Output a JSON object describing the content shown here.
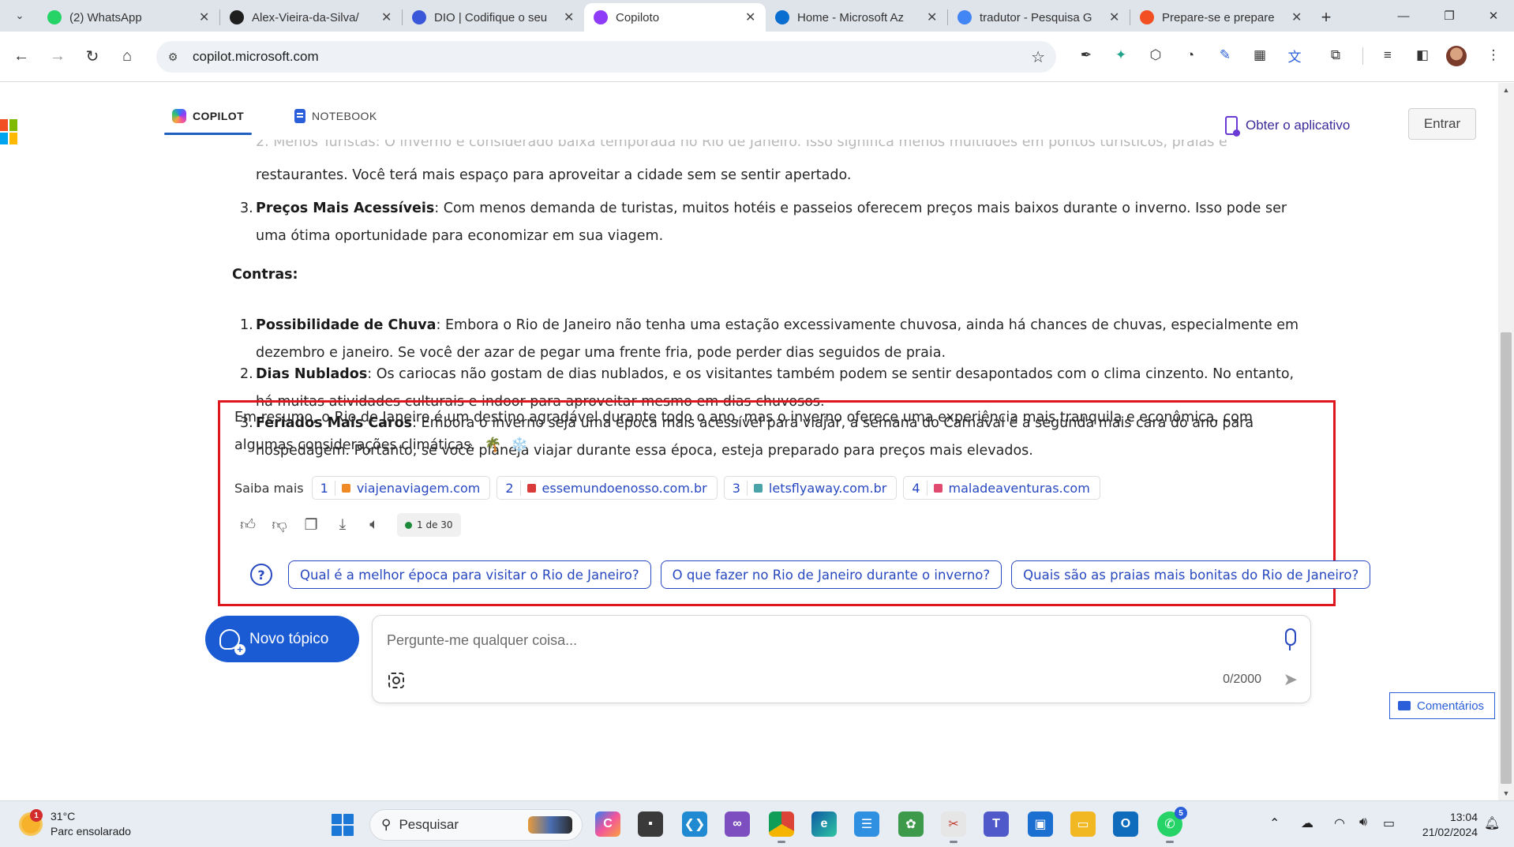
{
  "browser": {
    "tabs": [
      {
        "title": "(2) WhatsApp",
        "icon": "whatsapp-icon",
        "color": "#25d366",
        "active": false
      },
      {
        "title": "Alex-Vieira-da-Silva/",
        "icon": "github-icon",
        "color": "#1f1f1f",
        "active": false
      },
      {
        "title": "DIO | Codifique o seu",
        "icon": "dio-icon",
        "color": "#3b57d9",
        "active": false
      },
      {
        "title": "Copiloto",
        "icon": "copilot-icon",
        "color": "#8e3cf7",
        "active": true
      },
      {
        "title": "Home - Microsoft Az",
        "icon": "azure-icon",
        "color": "#0a6ed1",
        "active": false
      },
      {
        "title": "tradutor - Pesquisa G",
        "icon": "google-icon",
        "color": "#4285f4",
        "active": false
      },
      {
        "title": "Prepare-se e prepare",
        "icon": "microsoft-icon",
        "color": "#f25022",
        "active": false
      }
    ],
    "url": "copilot.microsoft.com"
  },
  "header": {
    "nav_copilot": "COPILOT",
    "nav_notebook": "NOTEBOOK",
    "get_app": "Obter o aplicativo",
    "sign_in": "Entrar"
  },
  "chat": {
    "clipped_item": "2.  Menos Turistas: O inverno é considerado baixa temporada no Rio de Janeiro. Isso significa menos multidões em pontos turísticos, praias e",
    "pros_item2_cont": "restaurantes. Você terá mais espaço para aproveitar a cidade sem se sentir apertado.",
    "pros_item3_num": "3.",
    "pros_item3_title": "Preços Mais Acessíveis",
    "pros_item3_body": ": Com menos demanda de turistas, muitos hotéis e passeios oferecem preços mais baixos durante o inverno. Isso pode ser uma ótima oportunidade para economizar em sua viagem.",
    "cons_heading": "Contras:",
    "cons": [
      {
        "num": "1.",
        "title": "Possibilidade de Chuva",
        "body": ": Embora o Rio de Janeiro não tenha uma estação excessivamente chuvosa, ainda há chances de chuvas, especialmente em dezembro e janeiro. Se você der azar de pegar uma frente fria, pode perder dias seguidos de praia."
      },
      {
        "num": "2.",
        "title": "Dias Nublados",
        "body": ": Os cariocas não gostam de dias nublados, e os visitantes também podem se sentir desapontados com o clima cinzento. No entanto, há muitas atividades culturais e indoor para aproveitar mesmo em dias chuvosos."
      },
      {
        "num": "3.",
        "title": "Feriados Mais Caros",
        "body": ": Embora o inverno seja uma época mais acessível para viajar, a semana do Carnaval é a segunda mais cara do ano para hospedagem. Portanto, se você planeja viajar durante essa época, esteja preparado para preços mais elevados."
      }
    ],
    "summary": "Em resumo, o Rio de Janeiro é um destino agradável durante todo o ano, mas o inverno oferece uma experiência mais tranquila e econômica, com algumas considerações climáticas.",
    "emoji_palm": "🌴",
    "emoji_snow": "❄️",
    "learn_more": "Saiba mais",
    "citations": [
      {
        "num": "1",
        "site": "viajenaviagem.com",
        "color": "#f08a24"
      },
      {
        "num": "2",
        "site": "essemundoenosso.com.br",
        "color": "#d93a3a"
      },
      {
        "num": "3",
        "site": "letsflyaway.com.br",
        "color": "#4aa3a8"
      },
      {
        "num": "4",
        "site": "maladeaventuras.com",
        "color": "#e04a6e"
      }
    ],
    "response_count": "1 de 30",
    "suggestions": [
      "Qual é a melhor época para visitar o Rio de Janeiro?",
      "O que fazer no Rio de Janeiro durante o inverno?",
      "Quais são as praias mais bonitas do Rio de Janeiro?"
    ]
  },
  "composer": {
    "new_topic": "Novo tópico",
    "placeholder": "Pergunte-me qualquer coisa...",
    "char_count": "0/2000"
  },
  "feedback": "Comentários",
  "taskbar": {
    "temperature": "31°C",
    "weather_desc": "Parc ensolarado",
    "weather_badge": "1",
    "search": "Pesquisar",
    "whatsapp_badge": "5",
    "time": "13:04",
    "date": "21/02/2024"
  },
  "colors": {
    "highlight_border": "#e0161e",
    "accent_blue": "#1a5bd4",
    "link_blue": "#2848c0"
  }
}
